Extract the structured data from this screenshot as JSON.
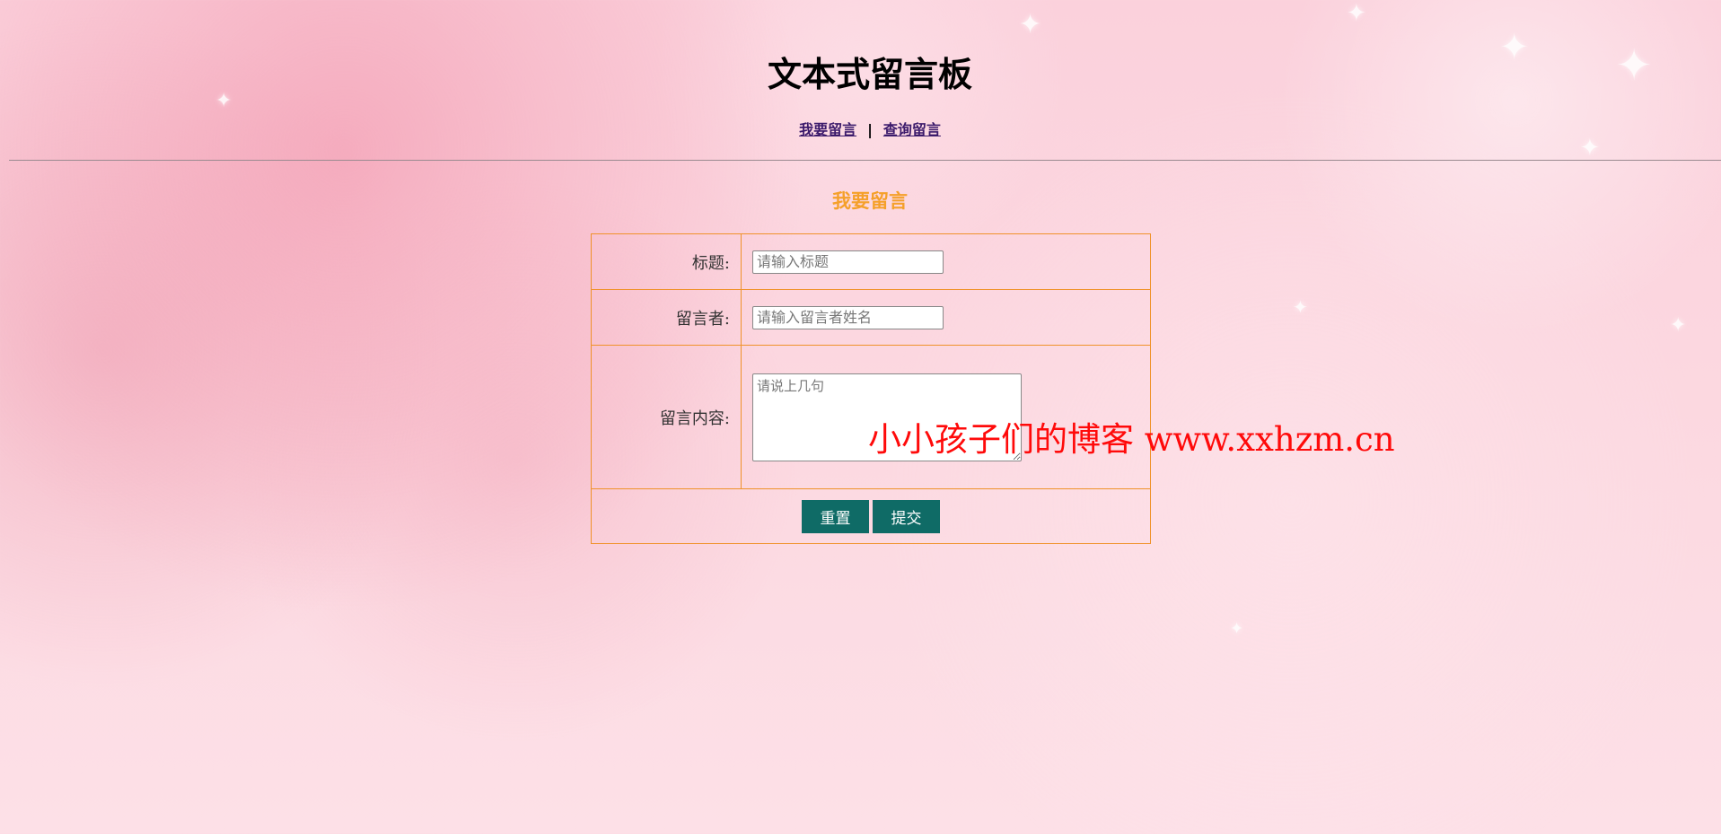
{
  "page": {
    "title": "文本式留言板"
  },
  "nav": {
    "write_link": "我要留言",
    "separator": "|",
    "query_link": "查询留言"
  },
  "section": {
    "title": "我要留言"
  },
  "form": {
    "title_label": "标题:",
    "title_placeholder": "请输入标题",
    "author_label": "留言者:",
    "author_placeholder": "请输入留言者姓名",
    "content_label": "留言内容:",
    "content_placeholder": "请说上几句",
    "reset_label": "重置",
    "submit_label": "提交"
  },
  "watermark": {
    "text": "小小孩子们的博客 www.xxhzm.cn"
  },
  "colors": {
    "accent_orange": "#f5a02a",
    "table_border": "#f0922a",
    "button_bg": "#0f6b66",
    "link": "#3b1a6b",
    "watermark": "#ff0a0a"
  }
}
